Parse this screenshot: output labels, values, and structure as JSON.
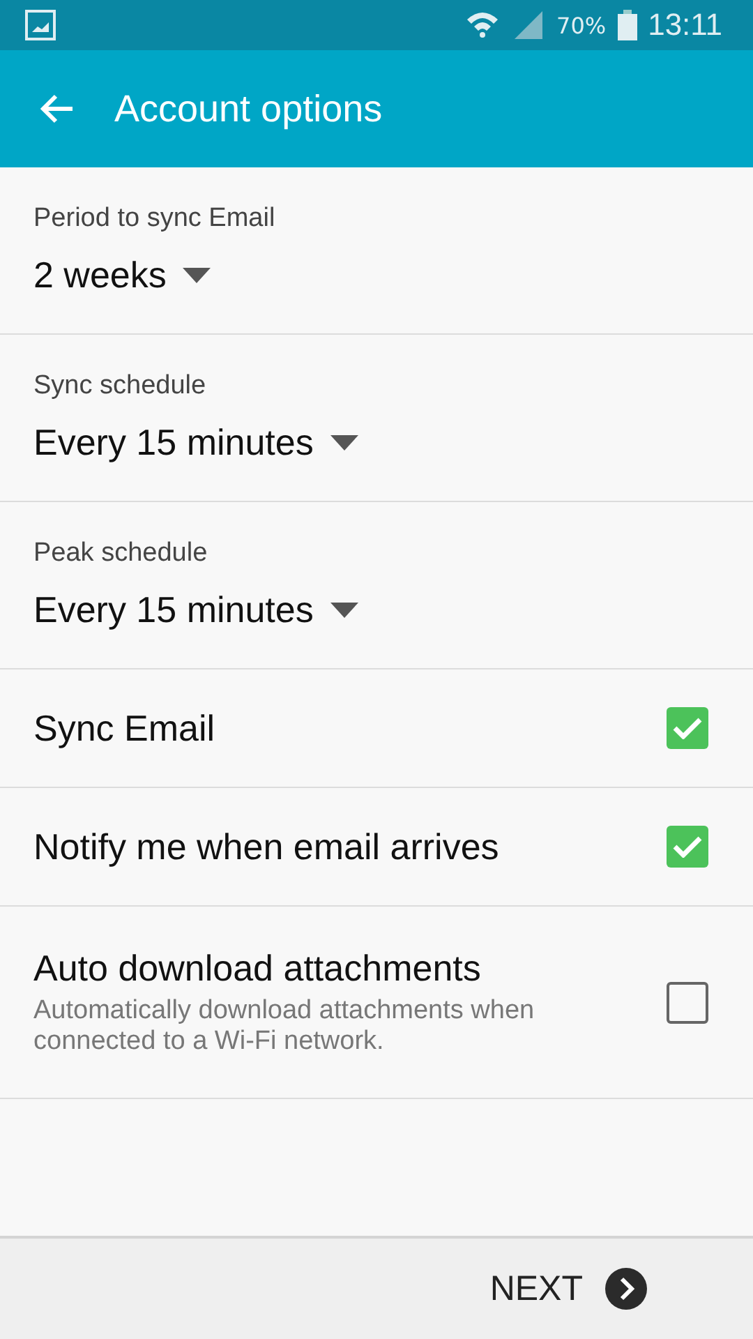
{
  "status_bar": {
    "battery": "70%",
    "time": "13:11"
  },
  "app_bar": {
    "title": "Account options"
  },
  "settings": [
    {
      "kind": "dropdown",
      "label": "Period to sync Email",
      "value": "2 weeks"
    },
    {
      "kind": "dropdown",
      "label": "Sync schedule",
      "value": "Every 15 minutes"
    },
    {
      "kind": "dropdown",
      "label": "Peak schedule",
      "value": "Every 15 minutes"
    },
    {
      "kind": "checkbox",
      "label": "Sync Email",
      "checked": true
    },
    {
      "kind": "checkbox",
      "label": "Notify me when email arrives",
      "checked": true
    },
    {
      "kind": "checkbox",
      "label": "Auto download attachments",
      "description": "Automatically download attachments when connected to a Wi-Fi network.",
      "checked": false
    }
  ],
  "footer": {
    "next_button": "NEXT"
  }
}
